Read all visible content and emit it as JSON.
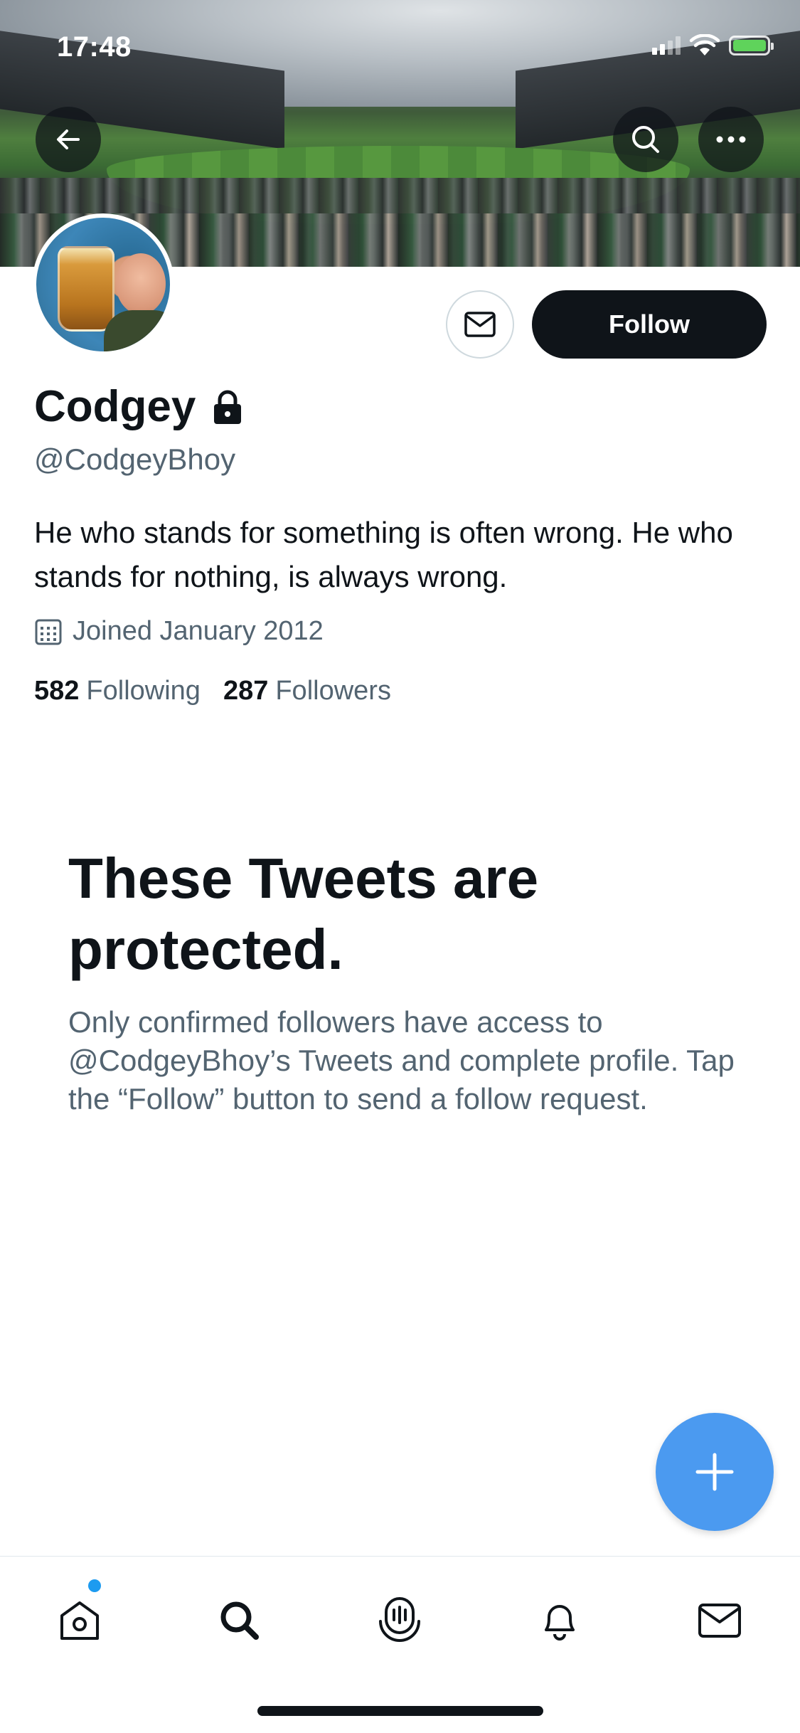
{
  "status_bar": {
    "time": "17:48",
    "signal_icon": "cellular-signal-icon",
    "wifi_icon": "wifi-icon",
    "battery_icon": "battery-charging-icon"
  },
  "header": {
    "back_icon": "arrow-left-icon",
    "search_icon": "search-icon",
    "more_icon": "more-horizontal-icon"
  },
  "profile": {
    "display_name": "Codgey",
    "lock_icon": "lock-icon",
    "handle": "@CodgeyBhoy",
    "bio": "He who stands for something is often wrong. He who stands for nothing, is always wrong.",
    "joined": "Joined January 2012",
    "calendar_icon": "calendar-icon",
    "following_count": "582",
    "following_label": "Following",
    "followers_count": "287",
    "followers_label": "Followers"
  },
  "actions": {
    "message_icon": "envelope-icon",
    "follow_label": "Follow"
  },
  "protected": {
    "title": "These Tweets are protected.",
    "body": "Only confirmed followers have access to @CodgeyBhoy’s Tweets and complete profile. Tap the “Follow” button to send a follow request."
  },
  "fab": {
    "icon": "plus-icon"
  },
  "tabbar": {
    "items": [
      {
        "name": "home",
        "icon": "home-icon",
        "has_notification_dot": true
      },
      {
        "name": "explore",
        "icon": "search-icon",
        "active": true
      },
      {
        "name": "spaces",
        "icon": "spaces-mic-icon"
      },
      {
        "name": "notifications",
        "icon": "bell-icon"
      },
      {
        "name": "messages",
        "icon": "envelope-icon"
      }
    ]
  },
  "colors": {
    "text_primary": "#0f1419",
    "text_secondary": "#536471",
    "fab_blue": "#4b9af0",
    "notification_dot": "#1d9bf0",
    "follow_button": "#0f1419"
  }
}
